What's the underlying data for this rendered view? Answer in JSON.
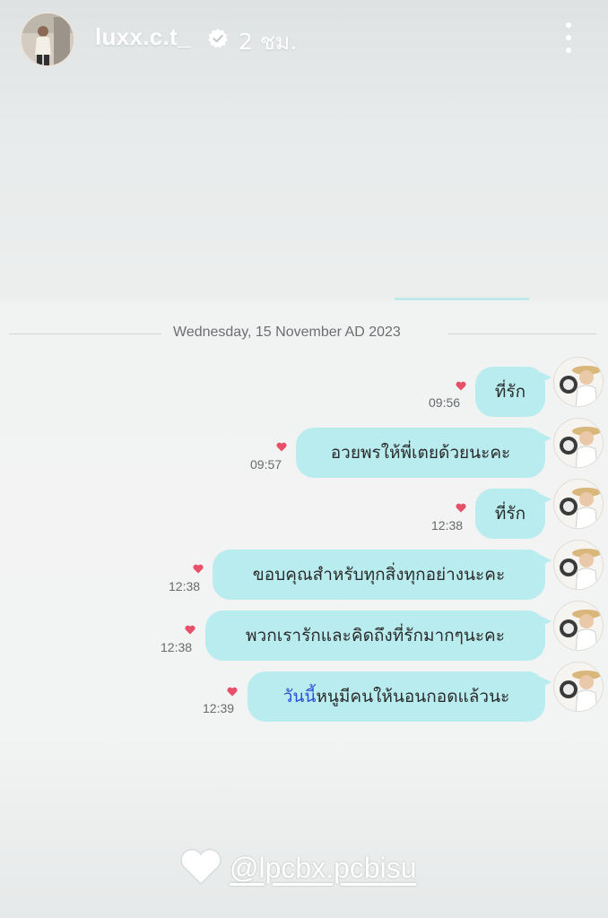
{
  "header": {
    "username": "luxx.c.t_",
    "time_ago": "2 ชม.",
    "verified": true
  },
  "chat": {
    "date": "Wednesday, 15 November AD 2023",
    "bubble_color": "#b9ecef",
    "heart_color": "#e8506a",
    "messages": [
      {
        "text": "ที่รัก",
        "time": "09:56"
      },
      {
        "text": "อวยพรให้พี่เตยด้วยนะคะ",
        "time": "09:57"
      },
      {
        "text": "ที่รัก",
        "time": "12:38"
      },
      {
        "text": "ขอบคุณสำหรับทุกสิ่งทุกอย่างนะคะ",
        "time": "12:38"
      },
      {
        "text": "พวกเรารักและคิดถึงที่รักมากๆนะคะ",
        "time": "12:38"
      },
      {
        "text_highlight": "วันนี้",
        "text_rest": "หนูมีคนให้นอนกอดแล้วนะ",
        "time": "12:39",
        "highlight_color": "#2a50d6"
      }
    ]
  },
  "mention": {
    "tag": "@lpcbx.pcbisu",
    "icon": "white-heart-icon"
  }
}
